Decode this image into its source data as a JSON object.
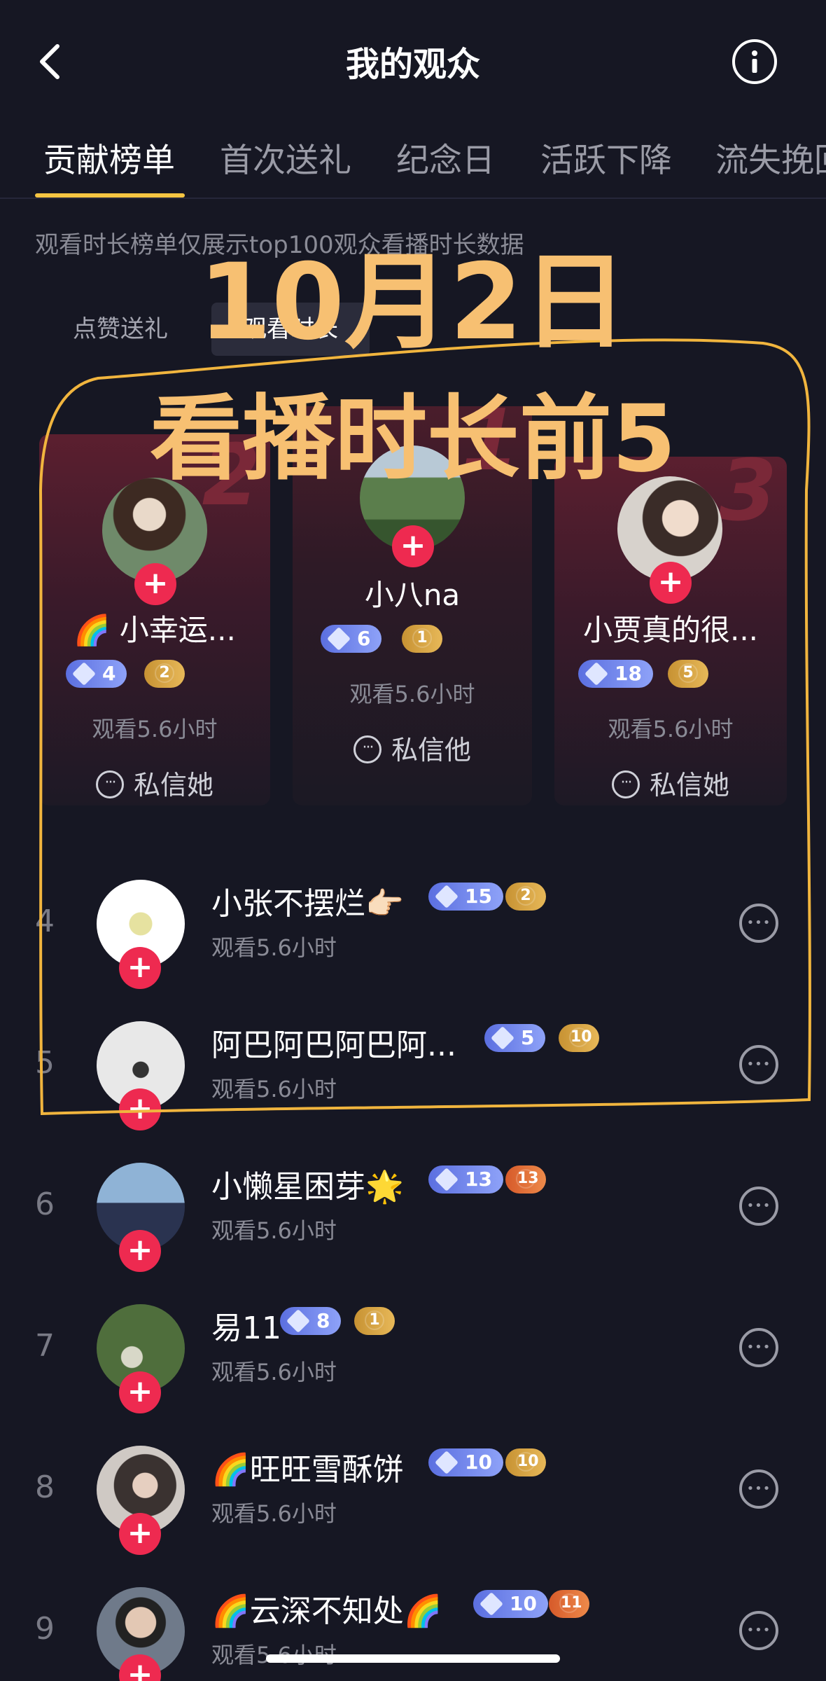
{
  "header": {
    "title": "我的观众"
  },
  "tabs": [
    {
      "label": "贡献榜单",
      "active": true
    },
    {
      "label": "首次送礼"
    },
    {
      "label": "纪念日"
    },
    {
      "label": "活跃下降"
    },
    {
      "label": "流失挽回"
    }
  ],
  "notice": "观看时长榜单仅展示top100观众看播时长数据",
  "toggle": {
    "likes": "点赞送礼",
    "watch": "观看时长"
  },
  "annotation": {
    "line1": "10月2日",
    "line2": "看播时长前5"
  },
  "podium": [
    {
      "rank": "2",
      "name": "🌈 小幸运...",
      "level": "4",
      "fan_level": "2",
      "watch": "观看5.6小时",
      "dm": "私信她"
    },
    {
      "rank": "1",
      "name": "小八na",
      "level": "6",
      "fan_level": "1",
      "watch": "观看5.6小时",
      "dm": "私信他"
    },
    {
      "rank": "3",
      "name": "小贾真的很...",
      "level": "18",
      "fan_level": "5",
      "watch": "观看5.6小时",
      "dm": "私信她"
    }
  ],
  "list": [
    {
      "rank": "4",
      "name": "小张不摆烂👉🏻",
      "level": "15",
      "fan_level": "2",
      "watch": "观看5.6小时"
    },
    {
      "rank": "5",
      "name": "阿巴阿巴阿巴阿...",
      "level": "5",
      "fan_level": "10",
      "watch": "观看5.6小时"
    },
    {
      "rank": "6",
      "name": "小懒星困芽🌟",
      "level": "13",
      "fan_level": "13",
      "watch": "观看5.6小时"
    },
    {
      "rank": "7",
      "name": "易11",
      "level": "8",
      "fan_level": "1",
      "watch": "观看5.6小时"
    },
    {
      "rank": "8",
      "name": "🌈旺旺雪酥饼",
      "level": "10",
      "fan_level": "10",
      "watch": "观看5.6小时"
    },
    {
      "rank": "9",
      "name": "🌈云深不知处🌈",
      "level": "10",
      "fan_level": "11",
      "watch": "观看5.6小时"
    }
  ],
  "icons": {
    "back": "chevron-left-icon",
    "info": "info-icon",
    "message": "message-bubble-icon",
    "level": "diamond-icon",
    "fan": "heart-badge-icon",
    "follow": "plus-icon"
  },
  "colors": {
    "background": "#161723",
    "accent_underline": "#f5c542",
    "follow_button": "#ee2a50",
    "annotation": "#f7c072",
    "level_badge": "#6e82ec",
    "fan_badge": "#d9a545"
  }
}
